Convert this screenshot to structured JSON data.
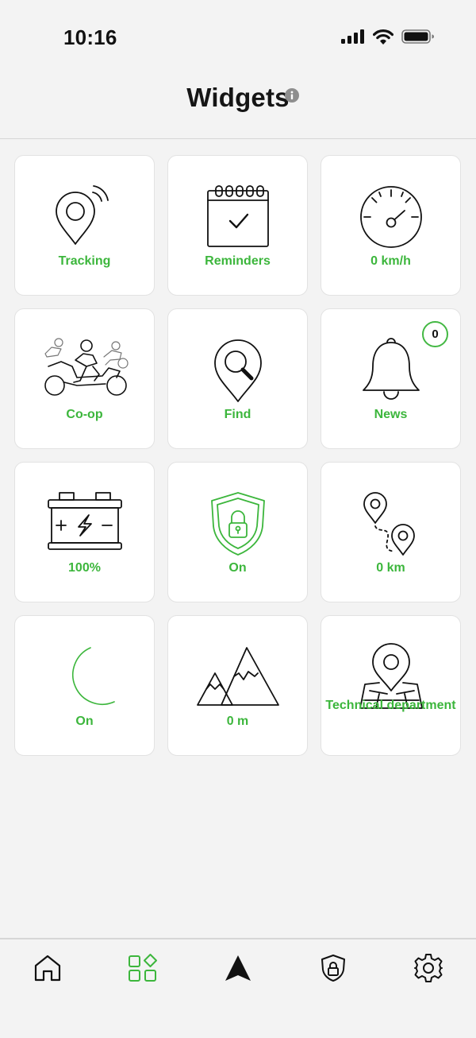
{
  "status_bar": {
    "time": "10:16"
  },
  "header": {
    "title": "Widgets"
  },
  "widgets": [
    {
      "label": "Tracking",
      "icon": "tracking-pin-icon"
    },
    {
      "label": "Reminders",
      "icon": "calendar-check-icon"
    },
    {
      "label": "0 km/h",
      "icon": "speedometer-icon"
    },
    {
      "label": "Co-op",
      "icon": "group-ride-icon"
    },
    {
      "label": "Find",
      "icon": "find-pin-icon"
    },
    {
      "label": "News",
      "icon": "bell-icon",
      "badge": "0"
    },
    {
      "label": "100%",
      "icon": "battery-icon"
    },
    {
      "label": "On",
      "icon": "shield-lock-icon"
    },
    {
      "label": "0 km",
      "icon": "route-icon"
    },
    {
      "label": "On",
      "icon": "moon-icon"
    },
    {
      "label": "0 m",
      "icon": "mountain-icon"
    },
    {
      "label": "Technical department",
      "icon": "map-pin-icon"
    }
  ],
  "bottom_nav": {
    "items": [
      "home-icon",
      "widgets-icon",
      "navigate-icon",
      "security-icon",
      "settings-icon"
    ],
    "active": "widgets-icon"
  },
  "colors": {
    "accent": "#3cb63c",
    "text": "#111111",
    "background": "#f3f3f3",
    "tile": "#ffffff"
  }
}
